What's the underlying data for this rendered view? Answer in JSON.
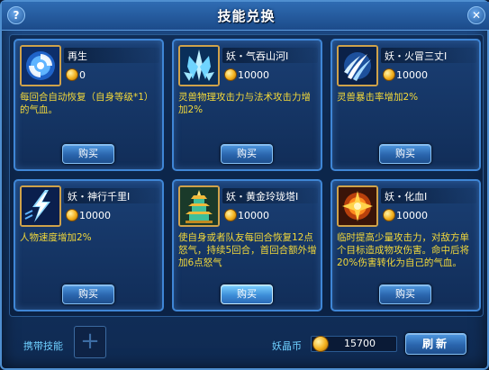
{
  "window": {
    "title": "技能兑换",
    "help_label": "?",
    "close_label": "✕"
  },
  "skills": [
    {
      "name": "再生",
      "price": "0",
      "desc": "每回合自动恢复（自身等级*1）的气血。",
      "buy_label": "购买",
      "icon": "regen-swirl-icon"
    },
    {
      "name": "妖・气吞山河I",
      "price": "10000",
      "desc": "灵兽物理攻击力与法术攻击力增加2%",
      "buy_label": "购买",
      "icon": "ice-crystal-icon"
    },
    {
      "name": "妖・火冒三丈I",
      "price": "10000",
      "desc": "灵兽暴击率增加2%",
      "buy_label": "购买",
      "icon": "claw-strike-icon"
    },
    {
      "name": "妖・神行千里I",
      "price": "10000",
      "desc": "人物速度增加2%",
      "buy_label": "购买",
      "icon": "lightning-boot-icon"
    },
    {
      "name": "妖・黄金玲珑塔I",
      "price": "10000",
      "desc": "使自身或者队友每回合恢复12点怒气，持续5回合，首回合额外增加6点怒气",
      "buy_label": "购买",
      "icon": "golden-pagoda-icon"
    },
    {
      "name": "妖・化血I",
      "price": "10000",
      "desc": "临时提高少量攻击力，对敌方单个目标造成物攻伤害。命中后将20%伤害转化为自己的气血。",
      "buy_label": "购买",
      "icon": "blood-burst-icon"
    }
  ],
  "footer": {
    "carry_label": "携带技能",
    "add_slot_symbol": "+",
    "currency_label": "妖晶币",
    "currency_value": "15700",
    "refresh_label": "刷新"
  },
  "colors": {
    "description_text": "#f2d83a",
    "label_accent": "#6fd0ff",
    "card_border": "#3f86d6",
    "icon_frame": "#cfa24a"
  }
}
